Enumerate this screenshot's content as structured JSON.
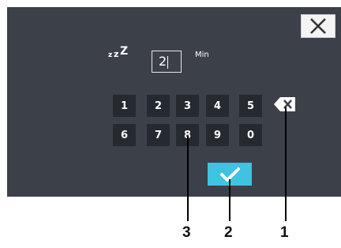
{
  "sleep_timer": {
    "icon": "sleep-zzz-icon",
    "icon_text": [
      "z",
      "z",
      "Z"
    ],
    "value": "2",
    "unit": "Min"
  },
  "keypad": {
    "row1": [
      "1",
      "2",
      "3",
      "4",
      "5"
    ],
    "row2": [
      "6",
      "7",
      "8",
      "9",
      "0"
    ]
  },
  "icons": {
    "close": "close-icon",
    "backspace": "backspace-icon",
    "confirm": "checkmark-icon"
  },
  "callouts": [
    "3",
    "2",
    "1"
  ],
  "colors": {
    "screen_bg": "#3b4049",
    "key_bg": "#252a31",
    "confirm_bg": "#3ec3e0"
  }
}
